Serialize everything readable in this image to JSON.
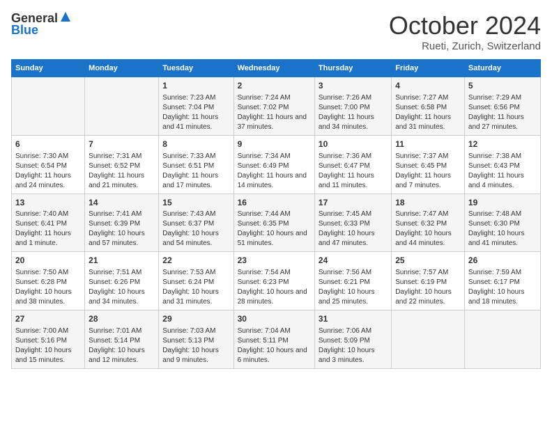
{
  "header": {
    "logo_general": "General",
    "logo_blue": "Blue",
    "month": "October 2024",
    "location": "Rueti, Zurich, Switzerland"
  },
  "days_of_week": [
    "Sunday",
    "Monday",
    "Tuesday",
    "Wednesday",
    "Thursday",
    "Friday",
    "Saturday"
  ],
  "weeks": [
    [
      {
        "day": "",
        "info": ""
      },
      {
        "day": "",
        "info": ""
      },
      {
        "day": "1",
        "info": "Sunrise: 7:23 AM\nSunset: 7:04 PM\nDaylight: 11 hours and 41 minutes."
      },
      {
        "day": "2",
        "info": "Sunrise: 7:24 AM\nSunset: 7:02 PM\nDaylight: 11 hours and 37 minutes."
      },
      {
        "day": "3",
        "info": "Sunrise: 7:26 AM\nSunset: 7:00 PM\nDaylight: 11 hours and 34 minutes."
      },
      {
        "day": "4",
        "info": "Sunrise: 7:27 AM\nSunset: 6:58 PM\nDaylight: 11 hours and 31 minutes."
      },
      {
        "day": "5",
        "info": "Sunrise: 7:29 AM\nSunset: 6:56 PM\nDaylight: 11 hours and 27 minutes."
      }
    ],
    [
      {
        "day": "6",
        "info": "Sunrise: 7:30 AM\nSunset: 6:54 PM\nDaylight: 11 hours and 24 minutes."
      },
      {
        "day": "7",
        "info": "Sunrise: 7:31 AM\nSunset: 6:52 PM\nDaylight: 11 hours and 21 minutes."
      },
      {
        "day": "8",
        "info": "Sunrise: 7:33 AM\nSunset: 6:51 PM\nDaylight: 11 hours and 17 minutes."
      },
      {
        "day": "9",
        "info": "Sunrise: 7:34 AM\nSunset: 6:49 PM\nDaylight: 11 hours and 14 minutes."
      },
      {
        "day": "10",
        "info": "Sunrise: 7:36 AM\nSunset: 6:47 PM\nDaylight: 11 hours and 11 minutes."
      },
      {
        "day": "11",
        "info": "Sunrise: 7:37 AM\nSunset: 6:45 PM\nDaylight: 11 hours and 7 minutes."
      },
      {
        "day": "12",
        "info": "Sunrise: 7:38 AM\nSunset: 6:43 PM\nDaylight: 11 hours and 4 minutes."
      }
    ],
    [
      {
        "day": "13",
        "info": "Sunrise: 7:40 AM\nSunset: 6:41 PM\nDaylight: 11 hours and 1 minute."
      },
      {
        "day": "14",
        "info": "Sunrise: 7:41 AM\nSunset: 6:39 PM\nDaylight: 10 hours and 57 minutes."
      },
      {
        "day": "15",
        "info": "Sunrise: 7:43 AM\nSunset: 6:37 PM\nDaylight: 10 hours and 54 minutes."
      },
      {
        "day": "16",
        "info": "Sunrise: 7:44 AM\nSunset: 6:35 PM\nDaylight: 10 hours and 51 minutes."
      },
      {
        "day": "17",
        "info": "Sunrise: 7:45 AM\nSunset: 6:33 PM\nDaylight: 10 hours and 47 minutes."
      },
      {
        "day": "18",
        "info": "Sunrise: 7:47 AM\nSunset: 6:32 PM\nDaylight: 10 hours and 44 minutes."
      },
      {
        "day": "19",
        "info": "Sunrise: 7:48 AM\nSunset: 6:30 PM\nDaylight: 10 hours and 41 minutes."
      }
    ],
    [
      {
        "day": "20",
        "info": "Sunrise: 7:50 AM\nSunset: 6:28 PM\nDaylight: 10 hours and 38 minutes."
      },
      {
        "day": "21",
        "info": "Sunrise: 7:51 AM\nSunset: 6:26 PM\nDaylight: 10 hours and 34 minutes."
      },
      {
        "day": "22",
        "info": "Sunrise: 7:53 AM\nSunset: 6:24 PM\nDaylight: 10 hours and 31 minutes."
      },
      {
        "day": "23",
        "info": "Sunrise: 7:54 AM\nSunset: 6:23 PM\nDaylight: 10 hours and 28 minutes."
      },
      {
        "day": "24",
        "info": "Sunrise: 7:56 AM\nSunset: 6:21 PM\nDaylight: 10 hours and 25 minutes."
      },
      {
        "day": "25",
        "info": "Sunrise: 7:57 AM\nSunset: 6:19 PM\nDaylight: 10 hours and 22 minutes."
      },
      {
        "day": "26",
        "info": "Sunrise: 7:59 AM\nSunset: 6:17 PM\nDaylight: 10 hours and 18 minutes."
      }
    ],
    [
      {
        "day": "27",
        "info": "Sunrise: 7:00 AM\nSunset: 5:16 PM\nDaylight: 10 hours and 15 minutes."
      },
      {
        "day": "28",
        "info": "Sunrise: 7:01 AM\nSunset: 5:14 PM\nDaylight: 10 hours and 12 minutes."
      },
      {
        "day": "29",
        "info": "Sunrise: 7:03 AM\nSunset: 5:13 PM\nDaylight: 10 hours and 9 minutes."
      },
      {
        "day": "30",
        "info": "Sunrise: 7:04 AM\nSunset: 5:11 PM\nDaylight: 10 hours and 6 minutes."
      },
      {
        "day": "31",
        "info": "Sunrise: 7:06 AM\nSunset: 5:09 PM\nDaylight: 10 hours and 3 minutes."
      },
      {
        "day": "",
        "info": ""
      },
      {
        "day": "",
        "info": ""
      }
    ]
  ]
}
